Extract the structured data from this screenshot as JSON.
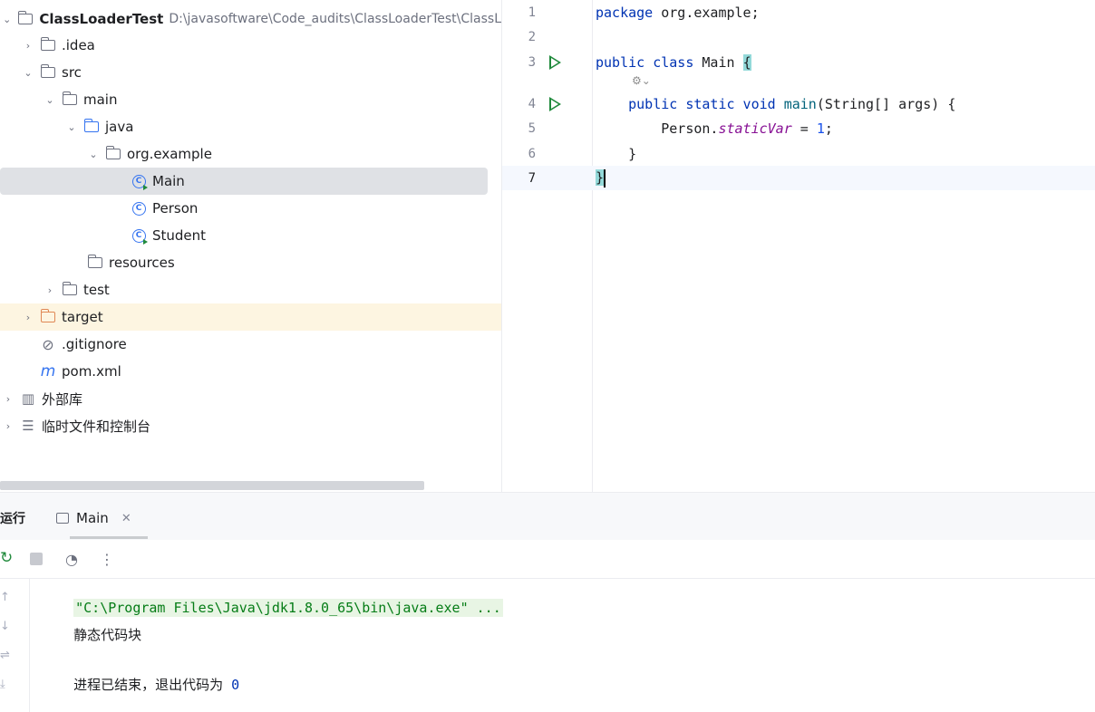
{
  "project": {
    "root_name": "ClassLoaderTest",
    "root_path": "D:\\javasoftware\\Code_audits\\ClassLoaderTest\\ClassL",
    "items": [
      {
        "label": ".idea"
      },
      {
        "label": "src"
      },
      {
        "label": "main"
      },
      {
        "label": "java"
      },
      {
        "label": "org.example"
      },
      {
        "label": "Main"
      },
      {
        "label": "Person"
      },
      {
        "label": "Student"
      },
      {
        "label": "resources"
      },
      {
        "label": "test"
      },
      {
        "label": "target"
      },
      {
        "label": ".gitignore"
      },
      {
        "label": "pom.xml"
      },
      {
        "label": "外部库"
      },
      {
        "label": "临时文件和控制台"
      }
    ]
  },
  "editor": {
    "line_numbers": [
      "1",
      "2",
      "3",
      "4",
      "5",
      "6",
      "7"
    ],
    "l1_kw": "package",
    "l1_rest": " org.example;",
    "l3_kw1": "public",
    "l3_kw2": "class",
    "l3_name": " Main ",
    "l3_brace": "{",
    "l4_kw": "public static void",
    "l4_fn": "main",
    "l4_rest": "(String[] args) {",
    "l5_a": "Person.",
    "l5_field": "staticVar",
    "l5_b": " = ",
    "l5_num": "1",
    "l5_c": ";",
    "l6": "}",
    "l7": "}"
  },
  "run": {
    "title": "运行",
    "tab_label": "Main",
    "console_cmd": "\"C:\\Program Files\\Java\\jdk1.8.0_65\\bin\\java.exe\" ...",
    "console_out": "静态代码块",
    "exit_text": "进程已结束，退出代码为 ",
    "exit_code": "0"
  }
}
